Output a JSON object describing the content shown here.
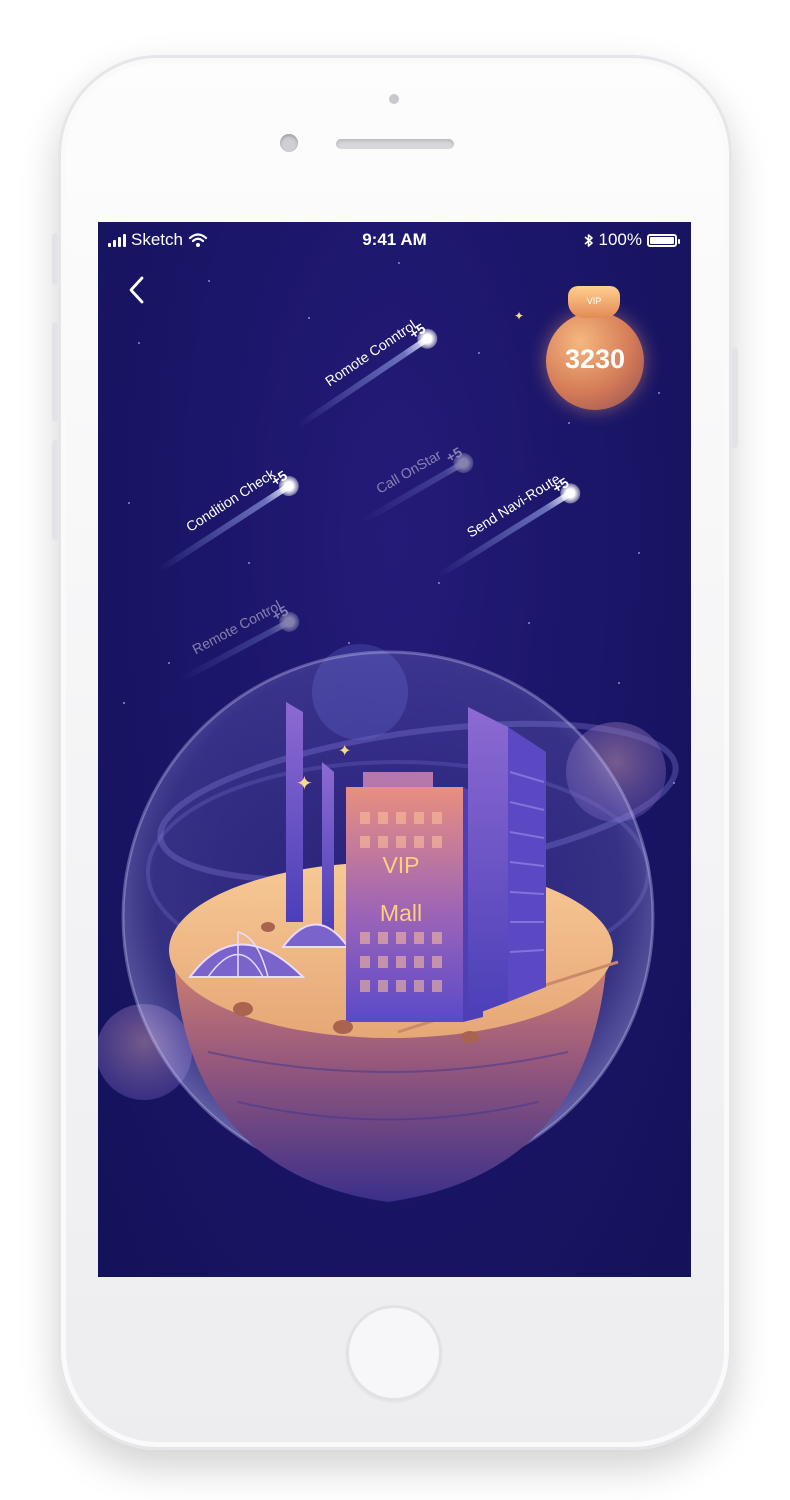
{
  "status_bar": {
    "carrier": "Sketch",
    "time": "9:41 AM",
    "battery": "100%"
  },
  "points": {
    "badge": "VIP",
    "value": "3230"
  },
  "tasks": [
    {
      "label": "Romote Conntrol",
      "bonus": "+5"
    },
    {
      "label": "Condition Check",
      "bonus": "+5"
    },
    {
      "label": "Call OnStar",
      "bonus": "+5"
    },
    {
      "label": "Send Navi-Route",
      "bonus": "+5"
    },
    {
      "label": "Remote Control",
      "bonus": "+5"
    }
  ],
  "building": {
    "line1": "VIP",
    "line2": "Mall"
  },
  "colors": {
    "sky": "#1b1669",
    "accent": "#ffd07a",
    "coin": "#e48a55"
  }
}
